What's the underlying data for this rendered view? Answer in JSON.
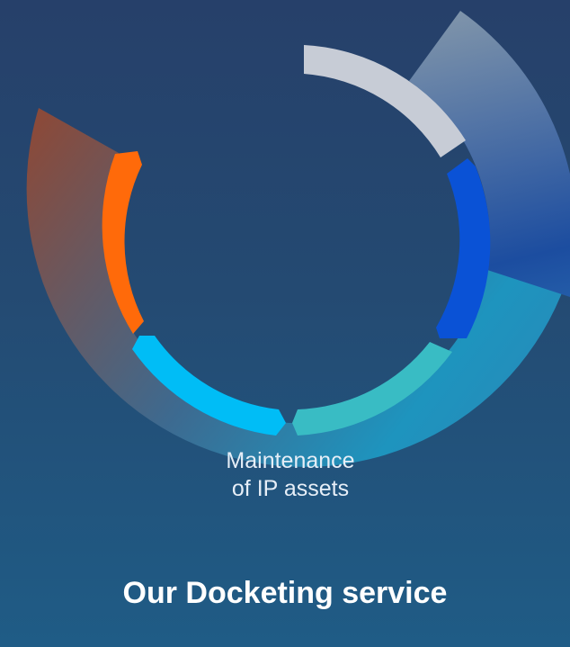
{
  "diagram": {
    "label_line1": "Maintenance",
    "label_line2": "of IP assets",
    "outer_band_colors": {
      "left_top": "#8a4a3a",
      "right_top": "#7f94aa",
      "right_mid": "#1c4da0",
      "bottom": "#1e94be"
    },
    "inner_segment_colors": [
      "#c7ccd6",
      "#0a52d6",
      "#39bcc4",
      "#00bdf6",
      "#ff6a0a"
    ]
  },
  "footer": {
    "title": "Our Docketing service"
  }
}
